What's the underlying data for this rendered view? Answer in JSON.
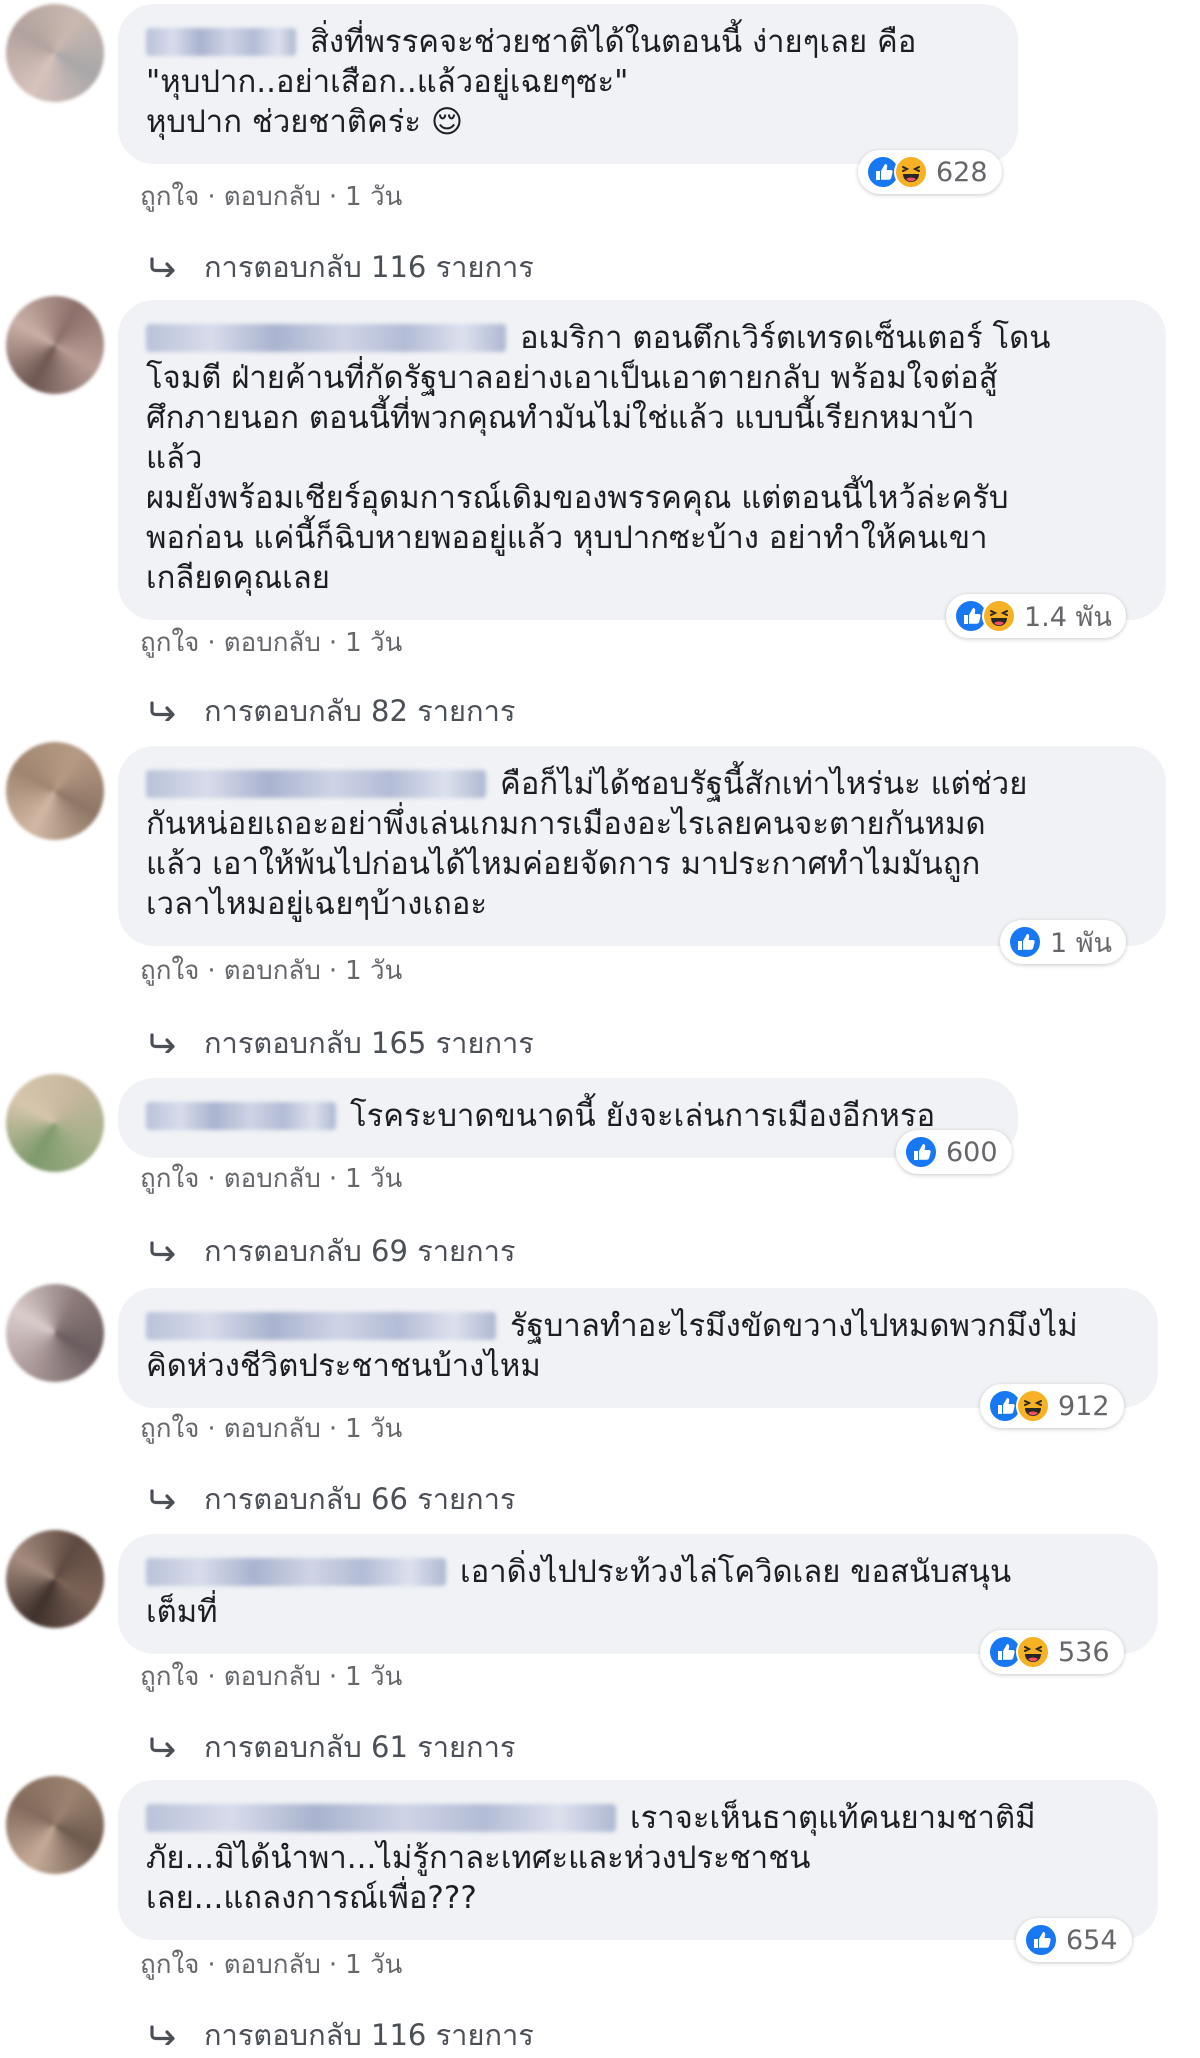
{
  "comments": [
    {
      "lines": [
        "สิ่งที่พรรคจะช่วยชาติได้ในตอนนี้ ง่ายๆเลย คือ",
        "\"หุบปาก..อย่าเสือก..แล้วอยู่เฉยๆซะ\"",
        "หุบปาก ช่วยชาติคร่ะ 😌"
      ],
      "reactions": "628",
      "reaction_types": [
        "like-icon",
        "haha-icon"
      ],
      "like_label": "ถูกใจ",
      "reply_label": "ตอบกลับ",
      "time": "1 วัน",
      "replies": "การตอบกลับ 116 รายการ"
    },
    {
      "lines": [
        "อเมริกา ตอนตึกเวิร์ตเทรดเซ็นเตอร์ โดน",
        "โจมตี ฝ่ายค้านที่กัดรัฐบาลอย่างเอาเป็นเอาตายกลับ พร้อมใจต่อสู้",
        "ศึกภายนอก ตอนนี้ที่พวกคุณทำมันไม่ใช่แล้ว แบบนี้เรียกหมาบ้า",
        "แล้ว",
        "ผมยังพร้อมเชียร์อุดมการณ์เดิมของพรรคคุณ แต่ตอนนี้ไหว้ล่ะครับ",
        "พอก่อน แค่นี้ก็ฉิบหายพออยู่แล้ว หุบปากซะบ้าง อย่าทำให้คนเขา",
        "เกลียดคุณเลย"
      ],
      "reactions": "1.4 พัน",
      "reaction_types": [
        "like-icon",
        "haha-icon"
      ],
      "like_label": "ถูกใจ",
      "reply_label": "ตอบกลับ",
      "time": "1 วัน",
      "replies": "การตอบกลับ 82 รายการ"
    },
    {
      "lines": [
        "คือก็ไม่ได้ชอบรัฐนี้สักเท่าไหร่นะ แต่ช่วย",
        "กันหน่อยเถอะอย่าพึ่งเล่นเกมการเมืองอะไรเลยคนจะตายกันหมด",
        "แล้ว เอาให้พ้นไปก่อนได้ไหมค่อยจัดการ มาประกาศทำไมมันถูก",
        "เวลาไหมอยู่เฉยๆบ้างเถอะ"
      ],
      "reactions": "1 พัน",
      "reaction_types": [
        "like-icon"
      ],
      "like_label": "ถูกใจ",
      "reply_label": "ตอบกลับ",
      "time": "1 วัน",
      "replies": "การตอบกลับ 165 รายการ"
    },
    {
      "lines": [
        "โรคระบาดขนาดนี้ ยังจะเล่นการเมืองอีกหรอ"
      ],
      "reactions": "600",
      "reaction_types": [
        "like-icon"
      ],
      "like_label": "ถูกใจ",
      "reply_label": "ตอบกลับ",
      "time": "1 วัน",
      "replies": "การตอบกลับ 69 รายการ"
    },
    {
      "lines": [
        "รัฐบาลทำอะไรมึงขัดขวางไปหมดพวกมึงไม่",
        "คิดห่วงชีวิตประชาชนบ้างไหม"
      ],
      "reactions": "912",
      "reaction_types": [
        "like-icon",
        "haha-icon"
      ],
      "like_label": "ถูกใจ",
      "reply_label": "ตอบกลับ",
      "time": "1 วัน",
      "replies": "การตอบกลับ 66 รายการ"
    },
    {
      "lines": [
        "เอาดิ่งไปประท้วงไล่โควิดเลย ขอสนับสนุน",
        "เต็มที่"
      ],
      "reactions": "536",
      "reaction_types": [
        "like-icon",
        "haha-icon"
      ],
      "like_label": "ถูกใจ",
      "reply_label": "ตอบกลับ",
      "time": "1 วัน",
      "replies": "การตอบกลับ 61 รายการ"
    },
    {
      "lines": [
        "เราจะเห็นธาตุแท้คนยามชาติมี",
        "ภัย...มิได้นำพา...ไม่รู้กาละเทศะและห่วงประชาชน",
        "เลย...แถลงการณ์เพื่อ???"
      ],
      "reactions": "654",
      "reaction_types": [
        "like-icon"
      ],
      "like_label": "ถูกใจ",
      "reply_label": "ตอบกลับ",
      "time": "1 วัน",
      "replies": "การตอบกลับ 116 รายการ"
    }
  ],
  "colors": {
    "bubble": "#f0f2f5",
    "like": "#1877f2",
    "haha": "#f7b125",
    "meta": "#65676b"
  }
}
